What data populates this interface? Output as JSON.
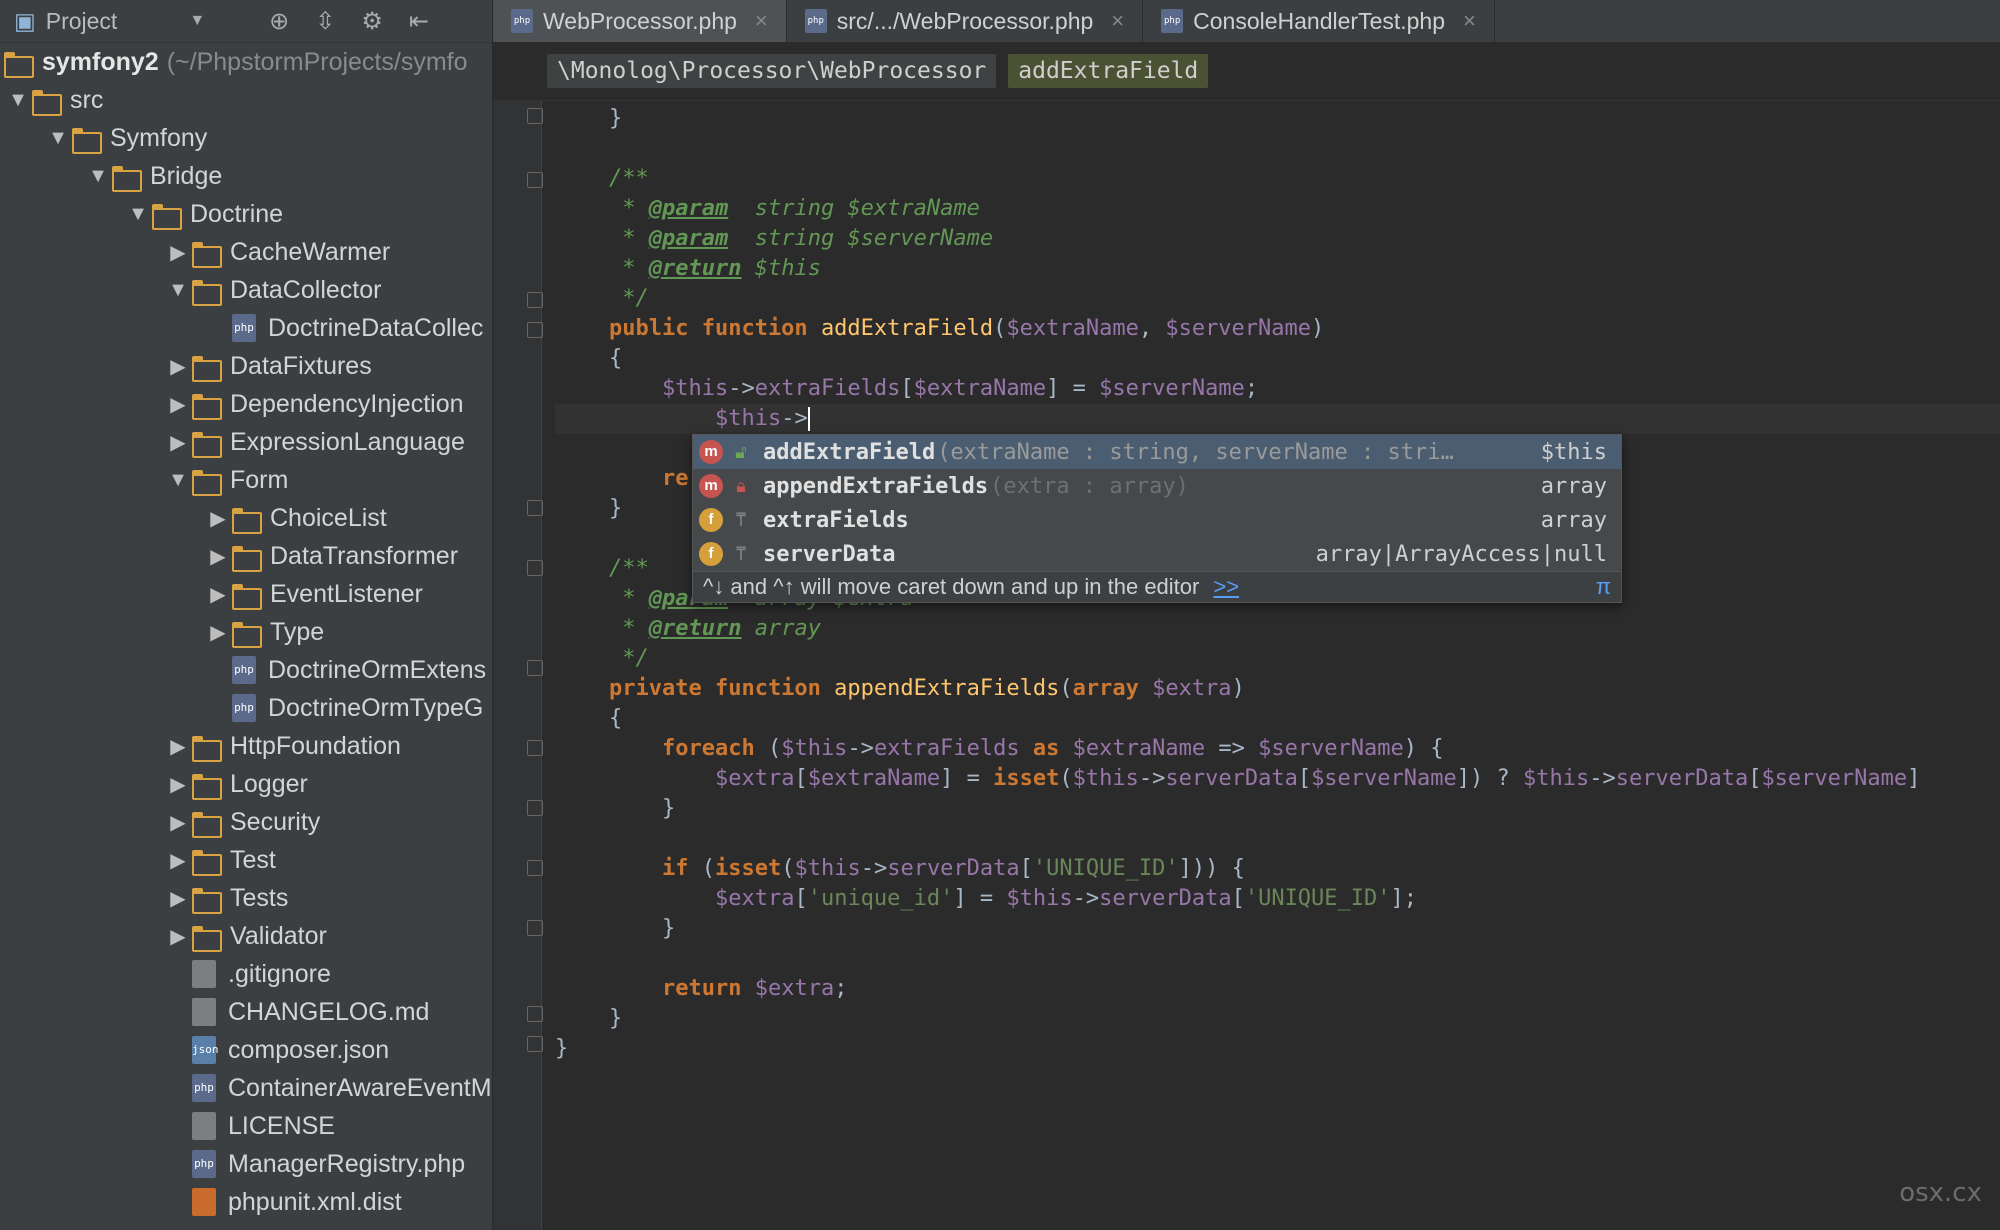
{
  "project_panel": {
    "title": "Project"
  },
  "tree": [
    {
      "tri": "",
      "kind": "folder",
      "label": "symfony2",
      "root_path": "(~/PhpstormProjects/symfo",
      "depth": 0
    },
    {
      "tri": "▼",
      "kind": "folder",
      "label": "src",
      "depth": 0
    },
    {
      "tri": "▼",
      "kind": "folder",
      "label": "Symfony",
      "depth": 1
    },
    {
      "tri": "▼",
      "kind": "folder",
      "label": "Bridge",
      "depth": 2
    },
    {
      "tri": "▼",
      "kind": "folder",
      "label": "Doctrine",
      "depth": 3
    },
    {
      "tri": "▶",
      "kind": "folder",
      "label": "CacheWarmer",
      "depth": 4
    },
    {
      "tri": "▼",
      "kind": "folder",
      "label": "DataCollector",
      "depth": 4
    },
    {
      "tri": "",
      "kind": "php",
      "label": "DoctrineDataCollec",
      "depth": 5
    },
    {
      "tri": "▶",
      "kind": "folder",
      "label": "DataFixtures",
      "depth": 4
    },
    {
      "tri": "▶",
      "kind": "folder",
      "label": "DependencyInjection",
      "depth": 4
    },
    {
      "tri": "▶",
      "kind": "folder",
      "label": "ExpressionLanguage",
      "depth": 4
    },
    {
      "tri": "▼",
      "kind": "folder",
      "label": "Form",
      "depth": 4
    },
    {
      "tri": "▶",
      "kind": "folder",
      "label": "ChoiceList",
      "depth": 5
    },
    {
      "tri": "▶",
      "kind": "folder",
      "label": "DataTransformer",
      "depth": 5
    },
    {
      "tri": "▶",
      "kind": "folder",
      "label": "EventListener",
      "depth": 5
    },
    {
      "tri": "▶",
      "kind": "folder",
      "label": "Type",
      "depth": 5
    },
    {
      "tri": "",
      "kind": "php",
      "label": "DoctrineOrmExtens",
      "depth": 5
    },
    {
      "tri": "",
      "kind": "php",
      "label": "DoctrineOrmTypeG",
      "depth": 5
    },
    {
      "tri": "▶",
      "kind": "folder",
      "label": "HttpFoundation",
      "depth": 4
    },
    {
      "tri": "▶",
      "kind": "folder",
      "label": "Logger",
      "depth": 4
    },
    {
      "tri": "▶",
      "kind": "folder",
      "label": "Security",
      "depth": 4
    },
    {
      "tri": "▶",
      "kind": "folder",
      "label": "Test",
      "depth": 4
    },
    {
      "tri": "▶",
      "kind": "folder",
      "label": "Tests",
      "depth": 4
    },
    {
      "tri": "▶",
      "kind": "folder",
      "label": "Validator",
      "depth": 4
    },
    {
      "tri": "",
      "kind": "txt",
      "label": ".gitignore",
      "depth": 4
    },
    {
      "tri": "",
      "kind": "txt",
      "label": "CHANGELOG.md",
      "depth": 4
    },
    {
      "tri": "",
      "kind": "json",
      "label": "composer.json",
      "depth": 4
    },
    {
      "tri": "",
      "kind": "php",
      "label": "ContainerAwareEventM",
      "depth": 4
    },
    {
      "tri": "",
      "kind": "txt",
      "label": "LICENSE",
      "depth": 4
    },
    {
      "tri": "",
      "kind": "php",
      "label": "ManagerRegistry.php",
      "depth": 4
    },
    {
      "tri": "",
      "kind": "xml",
      "label": "phpunit.xml.dist",
      "depth": 4
    }
  ],
  "tabs": [
    {
      "label": "WebProcessor.php",
      "active": true
    },
    {
      "label": "src/.../WebProcessor.php",
      "active": false
    },
    {
      "label": "ConsoleHandlerTest.php",
      "active": false
    }
  ],
  "breadcrumb": {
    "class_path": "\\Monolog\\Processor\\WebProcessor",
    "method": "addExtraField"
  },
  "completion": {
    "items": [
      {
        "kind": "m",
        "vis": "public",
        "name": "addExtraField",
        "sig": "(extraName : string, serverName : stri…",
        "type": "$this",
        "selected": true
      },
      {
        "kind": "m",
        "vis": "private",
        "name": "appendExtraFields",
        "sig": "(extra : array)",
        "type": "array",
        "selected": false
      },
      {
        "kind": "f",
        "vis": "field",
        "name": "extraFields",
        "sig": "",
        "type": "array",
        "selected": false
      },
      {
        "kind": "f",
        "vis": "field",
        "name": "serverData",
        "sig": "",
        "type": "array|ArrayAccess|null",
        "selected": false
      }
    ],
    "hint": "^↓ and ^↑ will move caret down and up in the editor",
    "hint_more": ">>",
    "hint_pi": "π"
  },
  "watermark": "osx.cx",
  "icons": {
    "php": "php",
    "json": "json"
  }
}
